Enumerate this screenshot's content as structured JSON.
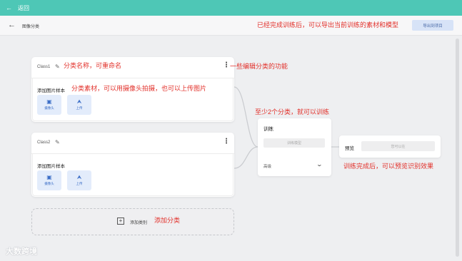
{
  "topbar": {
    "back_icon": "arrow-left-icon",
    "back_label": "返回"
  },
  "header": {
    "back_icon": "arrow-left-icon",
    "title": "图像分类",
    "export_button": "导出到项目"
  },
  "classes": [
    {
      "name": "Class1",
      "samples_label": "添加图片样本",
      "webcam_label": "摄像头",
      "upload_label": "上传"
    },
    {
      "name": "Class2",
      "samples_label": "添加图片样本",
      "webcam_label": "摄像头",
      "upload_label": "上传"
    }
  ],
  "add_class": {
    "label": "添加类别"
  },
  "training": {
    "title": "训练",
    "button": "训练模型",
    "advanced": "高级"
  },
  "preview": {
    "title": "预览",
    "button": "您可以在"
  },
  "annotations": {
    "rename": "分类名称，可重命名",
    "edit": "一些编辑分类的功能",
    "material": "分类素材，可以用摄像头拍摄，也可以上传图片",
    "min_classes": "至少2个分类，就可以训练",
    "export": "已经完成训练后，可以导出当前训练的素材和模型",
    "preview": "训练完成后，可以预览识别效果",
    "add_class": "添加分类"
  },
  "watermark": "大数跨境",
  "colors": {
    "topbar": "#4ec7b6",
    "annotation": "#e2302a",
    "button_bg": "#e3ecfb",
    "button_fg": "#3d6fc7"
  }
}
